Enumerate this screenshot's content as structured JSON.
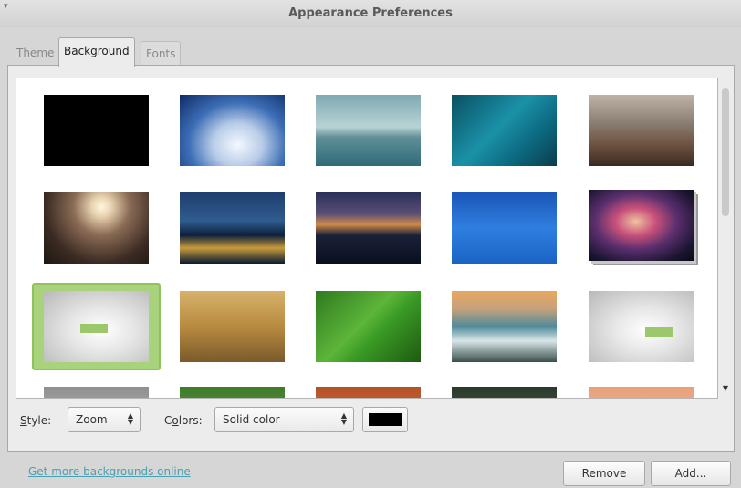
{
  "window": {
    "title": "Appearance Preferences"
  },
  "tabs": [
    {
      "label": "Theme"
    },
    {
      "label": "Background",
      "active": true
    },
    {
      "label": "Fonts"
    }
  ],
  "wallpapers": [
    {
      "name": "black",
      "selected": false
    },
    {
      "name": "clouds-sky",
      "selected": false
    },
    {
      "name": "misty-lake",
      "selected": false
    },
    {
      "name": "blue-water-boat",
      "selected": false
    },
    {
      "name": "bridge-city",
      "selected": false
    },
    {
      "name": "sunset-river-trees",
      "selected": false
    },
    {
      "name": "night-bridge-city",
      "selected": false
    },
    {
      "name": "city-night-dusk",
      "selected": false
    },
    {
      "name": "blue-water-surface",
      "selected": false
    },
    {
      "name": "orion-nebula",
      "selected": false
    },
    {
      "name": "mint-logo-grey",
      "selected": true
    },
    {
      "name": "wheat-field",
      "selected": false
    },
    {
      "name": "green-leaf",
      "selected": false
    },
    {
      "name": "sea-rocks-sunset",
      "selected": false
    },
    {
      "name": "mint-logo-grey-2",
      "selected": false
    },
    {
      "name": "partial-grey",
      "selected": false
    },
    {
      "name": "partial-green",
      "selected": false
    },
    {
      "name": "partial-orange",
      "selected": false
    },
    {
      "name": "partial-dark-landscape",
      "selected": false
    },
    {
      "name": "partial-peach",
      "selected": false
    }
  ],
  "style": {
    "label_prefix": "S",
    "label_rest": "tyle:",
    "value": "Zoom"
  },
  "colors": {
    "label_prefix": "C",
    "label_mid": "o",
    "label_rest": "lors:",
    "value": "Solid color",
    "swatch": "#000000"
  },
  "buttons": {
    "remove": "Remove",
    "add": "Add..."
  },
  "link": {
    "text": "Get more backgrounds online"
  },
  "theme_colors": {
    "accent_selection": "#a8d27c",
    "link": "#4a9fb0"
  }
}
